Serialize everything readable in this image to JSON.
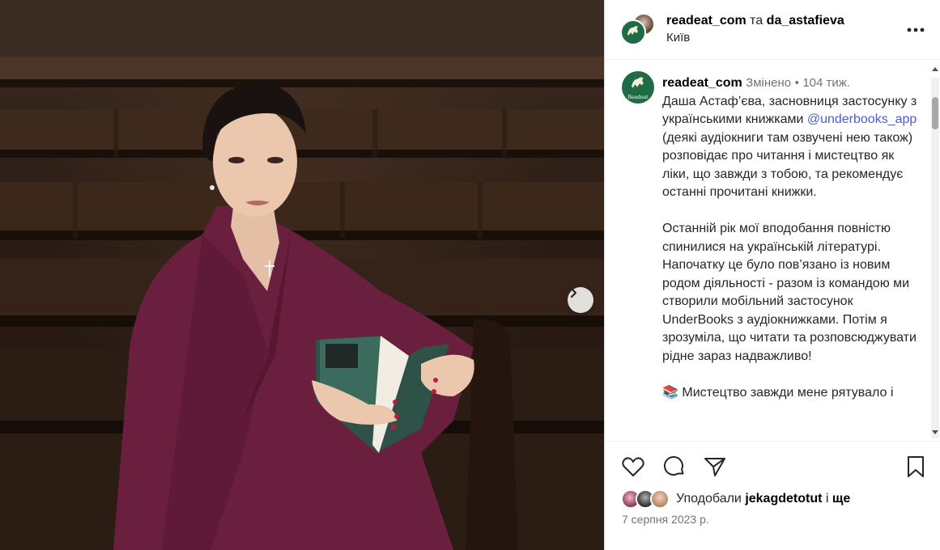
{
  "header": {
    "user1": "readeat_com",
    "and_word": "та",
    "user2": "da_astafieva",
    "location": "Київ"
  },
  "caption": {
    "username": "readeat_com",
    "edited": "Змінено",
    "separator": "•",
    "time_ago": "104 тиж.",
    "avatar_label": "Readeat",
    "p1_before": "Даша Астаф’єва, засновниця застосунку з українськими книжками ",
    "mention": "@underbooks_app",
    "p1_after": " (деякі аудіокниги там озвучені нею також) розповідає про читання і мистецтво як ліки, що завжди з тобою, та рекомендує останні прочитані книжки.",
    "p2": "Останній рік мої вподобання повністю спинилися на українській літературі. Напочатку це було пов’язано із новим родом діяльності - разом із командою ми створили мобільний застосунок UnderBooks з аудіокнижками. Потім я зрозуміла, що читати та розповсюджувати рідне зараз надважливо!",
    "p3": "📚 Мистецтво завжди мене рятувало і"
  },
  "likes": {
    "prefix": "Уподобали",
    "user": "jekagdetotut",
    "connector": "і",
    "suffix": "ще"
  },
  "date": "7 серпня 2023 р.",
  "icons": {
    "like": "heart-icon",
    "comment": "comment-icon",
    "share": "share-icon",
    "save": "bookmark-icon",
    "more": "more-icon",
    "next": "chevron-right-icon"
  },
  "colors": {
    "brand_green": "#1f6b45",
    "mention": "#4a5fd6",
    "secondary_text": "#737373"
  }
}
